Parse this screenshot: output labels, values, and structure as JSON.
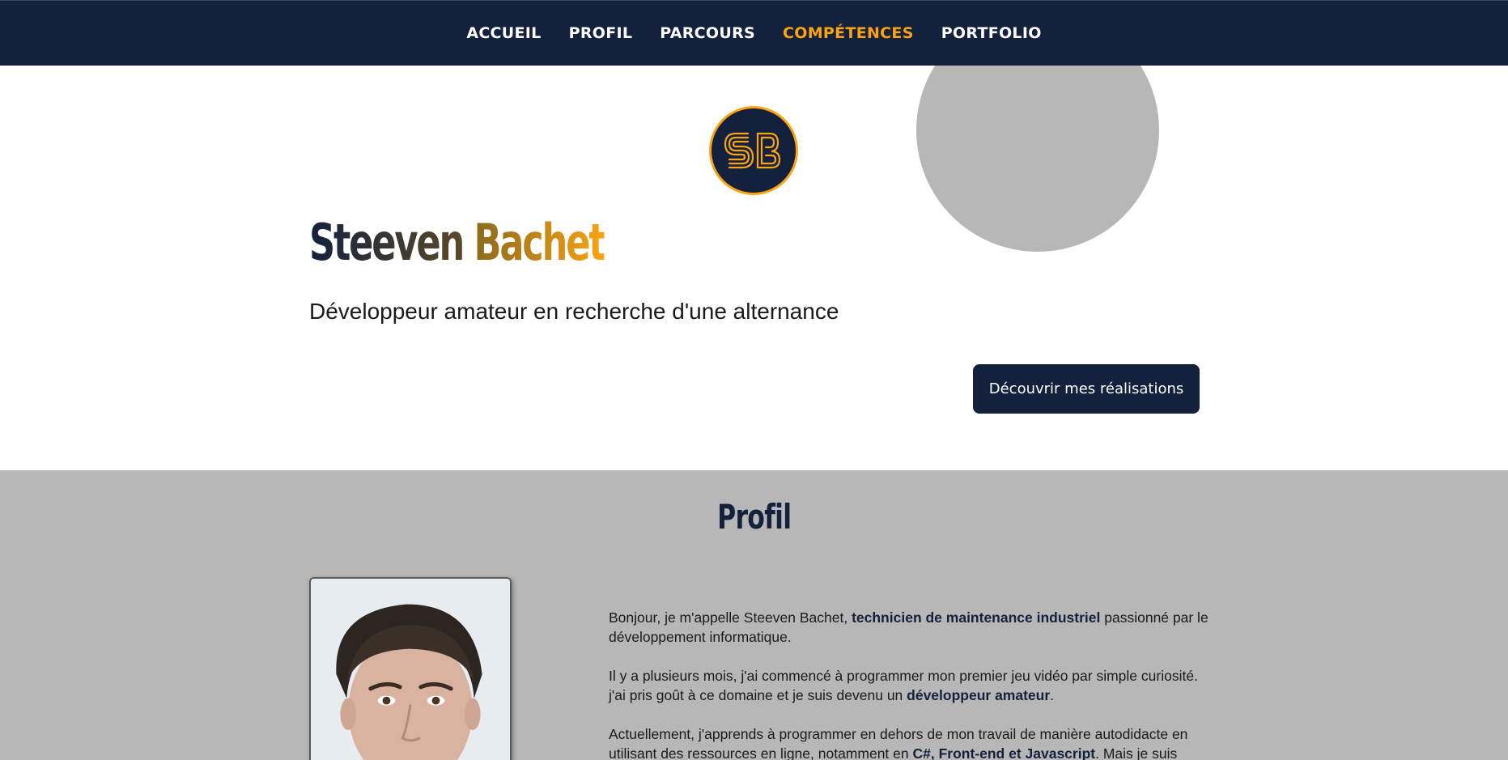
{
  "nav": {
    "items": [
      {
        "label": "ACCUEIL",
        "active": false
      },
      {
        "label": "PROFIL",
        "active": false
      },
      {
        "label": "PARCOURS",
        "active": false
      },
      {
        "label": "COMPÉTENCES",
        "active": true
      },
      {
        "label": "PORTFOLIO",
        "active": false
      }
    ]
  },
  "hero": {
    "logo_text": "SB",
    "first_name": "Steeven",
    "last_name": "Bachet",
    "subtitle": "Développeur amateur en recherche d'une alternance",
    "cta_label": "Découvrir mes réalisations"
  },
  "profil": {
    "title": "Profil",
    "p1_a": "Bonjour, je m'appelle Steeven Bachet, ",
    "p1_b": "technicien de maintenance industriel",
    "p1_c": " passionné par le développement informatique.",
    "p2_a": "Il y a plusieurs mois, j'ai commencé à programmer mon premier jeu vidéo par simple curiosité. j'ai pris goût à ce domaine et je suis devenu un ",
    "p2_b": "développeur amateur",
    "p2_c": ".",
    "p3_a": "Actuellement, j'apprends à programmer en dehors de mon travail de manière autodidacte en utilisant des ressources en ligne, notamment en ",
    "p3_b": "C#, Front-end et Javascript",
    "p3_c": ". Mais je suis"
  },
  "colors": {
    "navy": "#14213d",
    "accent": "#fca311",
    "gray": "#b7b7b7"
  }
}
